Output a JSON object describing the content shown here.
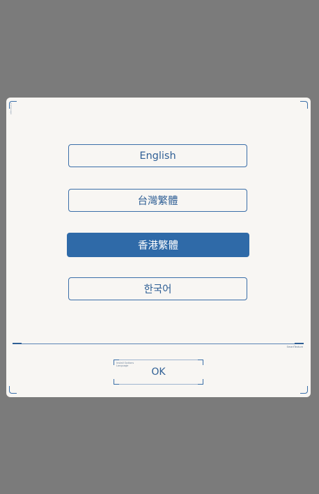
{
  "dialog": {
    "side_text": "Language",
    "languages": [
      {
        "label": "English",
        "selected": false
      },
      {
        "label": "台灣繁體",
        "selected": false
      },
      {
        "label": "香港繁體",
        "selected": true
      },
      {
        "label": "한국어",
        "selected": false
      }
    ],
    "divider_label": "SmartTexture",
    "ok": {
      "label": "OK",
      "mini_line1": "Install Options",
      "mini_line2": "Language"
    }
  },
  "colors": {
    "accent": "#2f6aa8",
    "overlay": "#7b7b7b",
    "panel": "#f8f6f3"
  }
}
